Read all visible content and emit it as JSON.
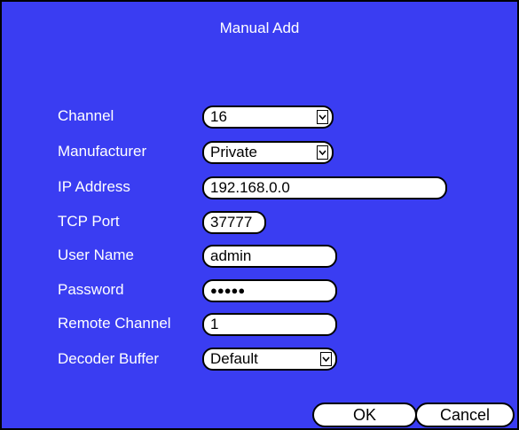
{
  "dialog": {
    "title": "Manual Add"
  },
  "fields": {
    "channel": {
      "label": "Channel",
      "value": "16"
    },
    "manufacturer": {
      "label": "Manufacturer",
      "value": "Private"
    },
    "ip_address": {
      "label": "IP Address",
      "value": "192.168.0.0"
    },
    "tcp_port": {
      "label": "TCP Port",
      "value": "37777"
    },
    "user_name": {
      "label": "User Name",
      "value": "admin"
    },
    "password": {
      "label": "Password",
      "value": "●●●●●"
    },
    "remote_channel": {
      "label": "Remote Channel",
      "value": "1"
    },
    "decoder_buffer": {
      "label": "Decoder Buffer",
      "value": "Default"
    }
  },
  "buttons": {
    "ok": "OK",
    "cancel": "Cancel"
  },
  "icons": {
    "dropdown": "chevron-down-icon"
  },
  "colors": {
    "background": "#3a3df2",
    "text": "#ffffff",
    "field": "#ffffff"
  }
}
